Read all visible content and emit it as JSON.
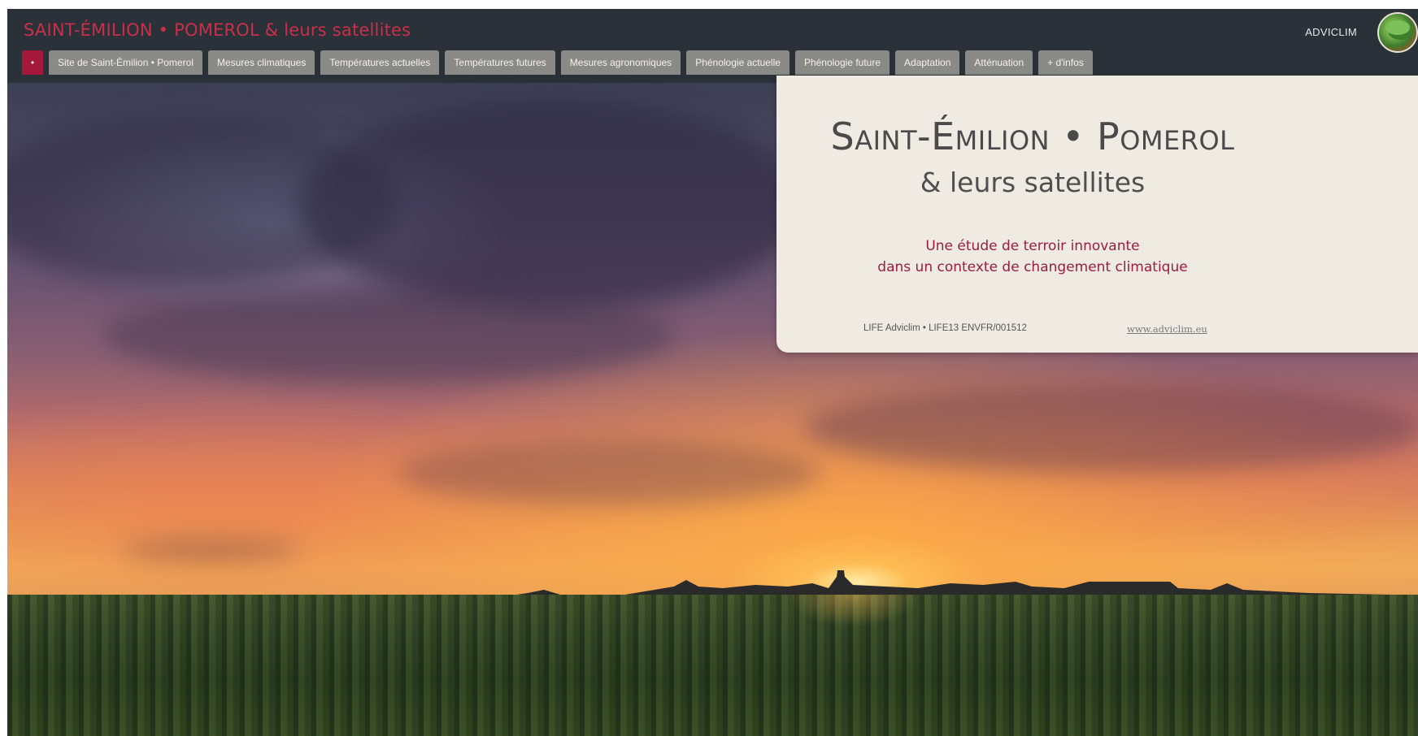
{
  "header": {
    "site_title": "SAINT-ÉMILION • POMEROL & leurs satellites",
    "brand": "ADVICLIM",
    "logo_icon": "vineyard-globe-icon"
  },
  "nav": {
    "home_label": "•",
    "items": [
      "Site de Saint-Émilion • Pomerol",
      "Mesures climatiques",
      "Températures actuelles",
      "Températures futures",
      "Mesures agronomiques",
      "Phénologie actuelle",
      "Phénologie future",
      "Adaptation",
      "Atténuation",
      "+ d'infos"
    ]
  },
  "card": {
    "title": "Saint-Émilion • Pomerol",
    "subtitle": "& leurs satellites",
    "tagline_line1": "Une étude de terroir innovante",
    "tagline_line2": "dans un contexte de changement climatique",
    "reference": "LIFE Adviclim • LIFE13 ENVFR/001512",
    "link": "www.adviclim.eu"
  },
  "colors": {
    "header_bg": "#2a3138",
    "title_red": "#c8304a",
    "active_tab": "#a5173b",
    "tab_bg": "#8a8a86",
    "card_bg": "#efebe3",
    "tagline": "#9b1d3a"
  }
}
